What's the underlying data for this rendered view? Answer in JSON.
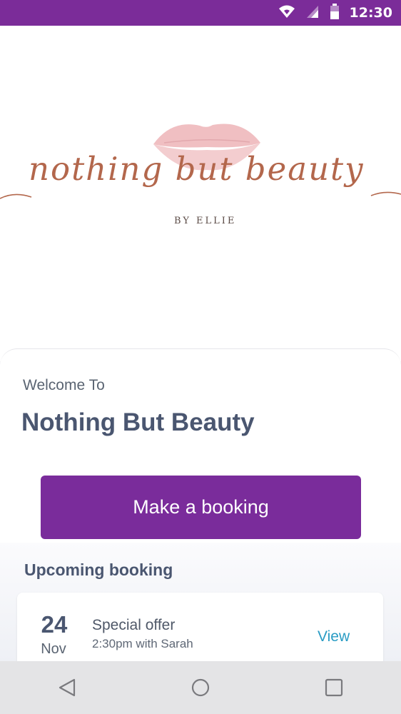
{
  "status_bar": {
    "time": "12:30",
    "icons": [
      "wifi-icon",
      "signal-icon",
      "battery-icon"
    ]
  },
  "logo": {
    "script_text": "nothing but beauty",
    "byline": "BY ELLIE"
  },
  "welcome": {
    "subtitle": "Welcome To",
    "title": "Nothing But Beauty"
  },
  "actions": {
    "make_booking_label": "Make a booking"
  },
  "upcoming": {
    "heading": "Upcoming booking",
    "booking": {
      "day": "24",
      "month": "Nov",
      "title": "Special offer",
      "detail": "2:30pm with Sarah",
      "view_label": "View"
    }
  },
  "nav_bar": {
    "buttons": [
      "back-icon",
      "home-icon",
      "recents-icon"
    ]
  },
  "colors": {
    "brand_purple": "#7a2c9b",
    "text_slate": "#4a5670",
    "link_blue": "#2a9cc4",
    "rose_gold": "#b3674c",
    "lips_pink": "#f3c9cb"
  }
}
